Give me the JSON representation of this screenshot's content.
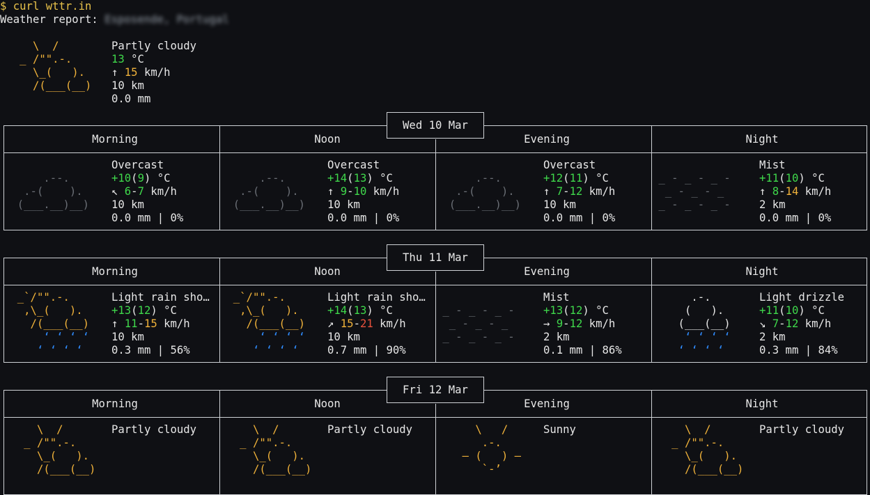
{
  "prompt": {
    "symbol": "$",
    "command": "curl wttr.in"
  },
  "report_label": "Weather report:",
  "location": "Esposende, Portugal",
  "current": {
    "condition": "Partly cloudy",
    "temp": "13",
    "temp_unit": "°C",
    "wind_arrow": "↑",
    "wind": "15",
    "wind_unit": "km/h",
    "visibility": "10 km",
    "precip": "0.0 mm"
  },
  "columns": [
    "Morning",
    "Noon",
    "Evening",
    "Night"
  ],
  "days": [
    {
      "date": "Wed 10 Mar",
      "periods": [
        {
          "condition": "Overcast",
          "temp_a": "+10",
          "temp_b": "9",
          "wind_arrow": "↖",
          "wind_a": "6",
          "wind_b": "7",
          "visibility": "10 km",
          "precip": "0.0 mm | 0%",
          "art": "overcast"
        },
        {
          "condition": "Overcast",
          "temp_a": "+14",
          "temp_b": "13",
          "wind_arrow": "↑",
          "wind_a": "9",
          "wind_b": "10",
          "visibility": "10 km",
          "precip": "0.0 mm | 0%",
          "art": "overcast"
        },
        {
          "condition": "Overcast",
          "temp_a": "+12",
          "temp_b": "11",
          "wind_arrow": "↑",
          "wind_a": "7",
          "wind_b": "12",
          "visibility": "10 km",
          "precip": "0.0 mm | 0%",
          "art": "overcast"
        },
        {
          "condition": "Mist",
          "temp_a": "+11",
          "temp_b": "10",
          "wind_arrow": "↑",
          "wind_a": "8",
          "wind_b": "14",
          "visibility": "2 km",
          "precip": "0.0 mm | 0%",
          "art": "mist"
        }
      ]
    },
    {
      "date": "Thu 11 Mar",
      "periods": [
        {
          "condition": "Light rain sho…",
          "temp_a": "+13",
          "temp_b": "12",
          "wind_arrow": "↑",
          "wind_a": "11",
          "wind_b": "15",
          "visibility": "10 km",
          "precip": "0.3 mm | 56%",
          "art": "shower"
        },
        {
          "condition": "Light rain sho…",
          "temp_a": "+14",
          "temp_b": "13",
          "wind_arrow": "↗",
          "wind_a": "15",
          "wind_b": "21",
          "visibility": "10 km",
          "precip": "0.7 mm | 90%",
          "art": "shower"
        },
        {
          "condition": "Mist",
          "temp_a": "+13",
          "temp_b": "12",
          "wind_arrow": "→",
          "wind_a": "9",
          "wind_b": "12",
          "visibility": "2 km",
          "precip": "0.1 mm | 86%",
          "art": "mist"
        },
        {
          "condition": "Light drizzle",
          "temp_a": "+11",
          "temp_b": "10",
          "wind_arrow": "↘",
          "wind_a": "7",
          "wind_b": "12",
          "visibility": "2 km",
          "precip": "0.3 mm | 84%",
          "art": "drizzle"
        }
      ]
    },
    {
      "date": "Fri 12 Mar",
      "periods": [
        {
          "condition": "Partly cloudy",
          "art": "partly"
        },
        {
          "condition": "Partly cloudy",
          "art": "partly"
        },
        {
          "condition": "Sunny",
          "art": "sunny"
        },
        {
          "condition": "Partly cloudy",
          "art": "partly"
        }
      ]
    }
  ],
  "colors": {
    "temp": "#3fd84b",
    "wind_mid": "#f0b23a",
    "wind_high": "#e8513c",
    "sun": "#e8c24a",
    "rain": "#2f8cff",
    "cloud": "#6a6e75"
  }
}
